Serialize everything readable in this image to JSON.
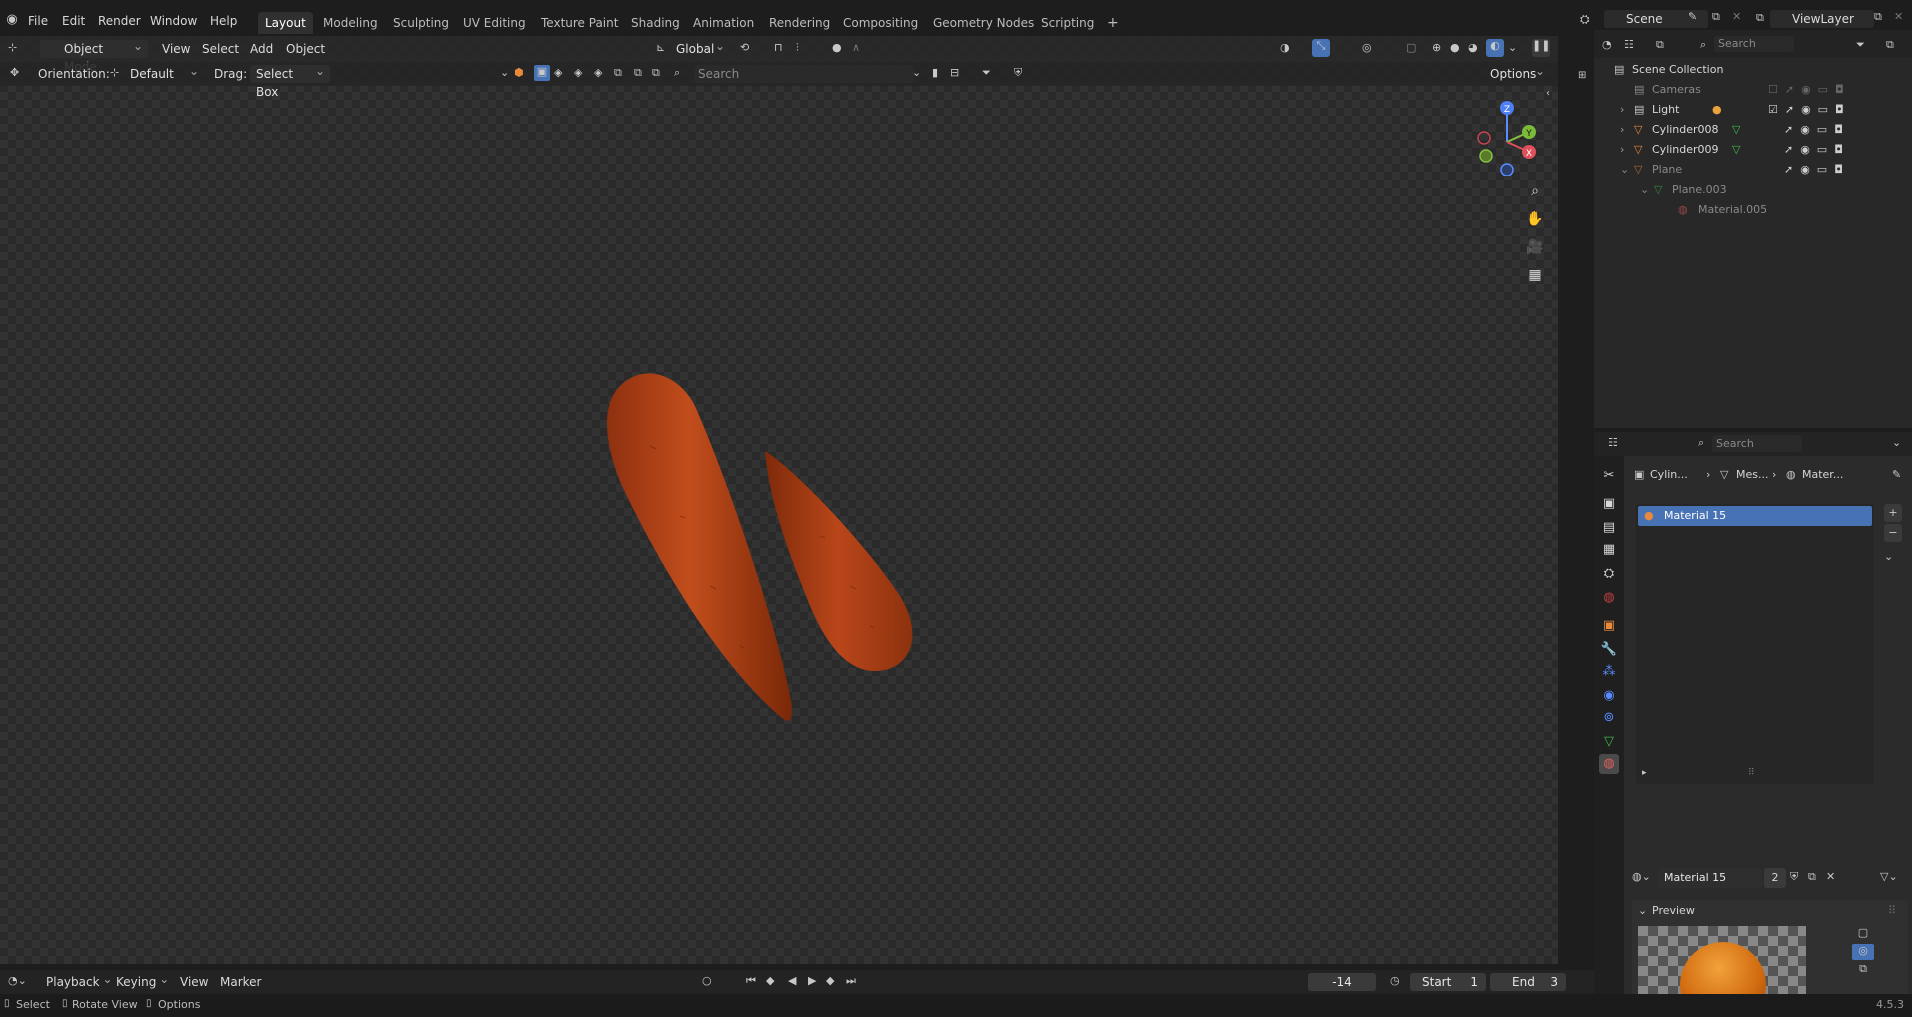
{
  "top_menu": {
    "items": [
      "File",
      "Edit",
      "Render",
      "Window",
      "Help"
    ]
  },
  "workspaces": {
    "tabs": [
      "Layout",
      "Modeling",
      "Sculpting",
      "UV Editing",
      "Texture Paint",
      "Shading",
      "Animation",
      "Rendering",
      "Compositing",
      "Geometry Nodes",
      "Scripting"
    ],
    "active": "Layout",
    "add_label": "+"
  },
  "scene": {
    "label": "Scene"
  },
  "view_layer": {
    "label": "ViewLayer"
  },
  "viewport_header": {
    "mode": "Object Mode",
    "menus": [
      "View",
      "Select",
      "Add",
      "Object"
    ],
    "transform_orientation": "Global",
    "options_label": "Options"
  },
  "tool_settings": {
    "orientation_label": "Orientation:",
    "orientation_value": "Default",
    "drag_label": "Drag:",
    "drag_value": "Select Box",
    "search_placeholder": "Search"
  },
  "gizmo": {
    "x": "X",
    "y": "Y",
    "z": "Z"
  },
  "outliner": {
    "search_placeholder": "Search",
    "root": "Scene Collection",
    "items": [
      {
        "name": "Cameras",
        "dim": true
      },
      {
        "name": "Light",
        "dim": false
      },
      {
        "name": "Cylinder008",
        "dim": false
      },
      {
        "name": "Cylinder009",
        "dim": false
      },
      {
        "name": "Plane",
        "dim": true
      },
      {
        "name": "Plane.003",
        "dim": true
      },
      {
        "name": "Material.005",
        "dim": true
      }
    ]
  },
  "properties": {
    "search_placeholder": "Search",
    "breadcrumb": [
      "Cylin...",
      "Mes...",
      "Mater..."
    ],
    "material_slot": "Material 15",
    "material_name": "Material 15",
    "user_count": "2",
    "preview_label": "Preview"
  },
  "timeline": {
    "menus": [
      "Playback",
      "Keying",
      "View",
      "Marker"
    ],
    "current_frame": "-14",
    "start_label": "Start",
    "start_value": "1",
    "end_label": "End",
    "end_value": "3"
  },
  "statusbar": {
    "select": "Select",
    "rotate_view": "Rotate View",
    "options": "Options",
    "version": "4.5.3"
  },
  "colors": {
    "accent_blue": "#4772b3",
    "carrot": "#b8481a",
    "mesh_green": "#3fb950",
    "object_orange": "#e8893c"
  }
}
